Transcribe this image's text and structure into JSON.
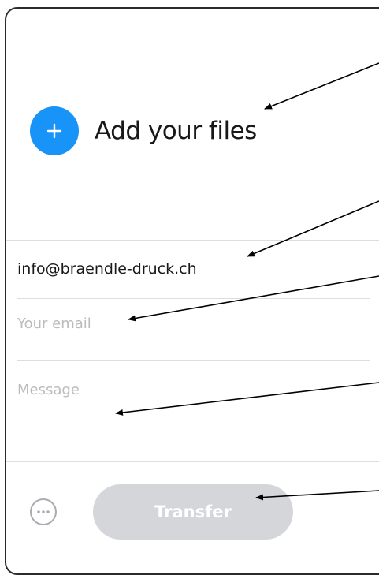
{
  "upload": {
    "add_files_label": "Add your files",
    "icon": "plus-icon",
    "accent_color": "#1893f8"
  },
  "form": {
    "recipient_value": "info@braendle-druck.ch",
    "email_placeholder": "Your email",
    "message_placeholder": "Message"
  },
  "footer": {
    "more_icon": "more-options-icon",
    "transfer_label": "Transfer"
  }
}
